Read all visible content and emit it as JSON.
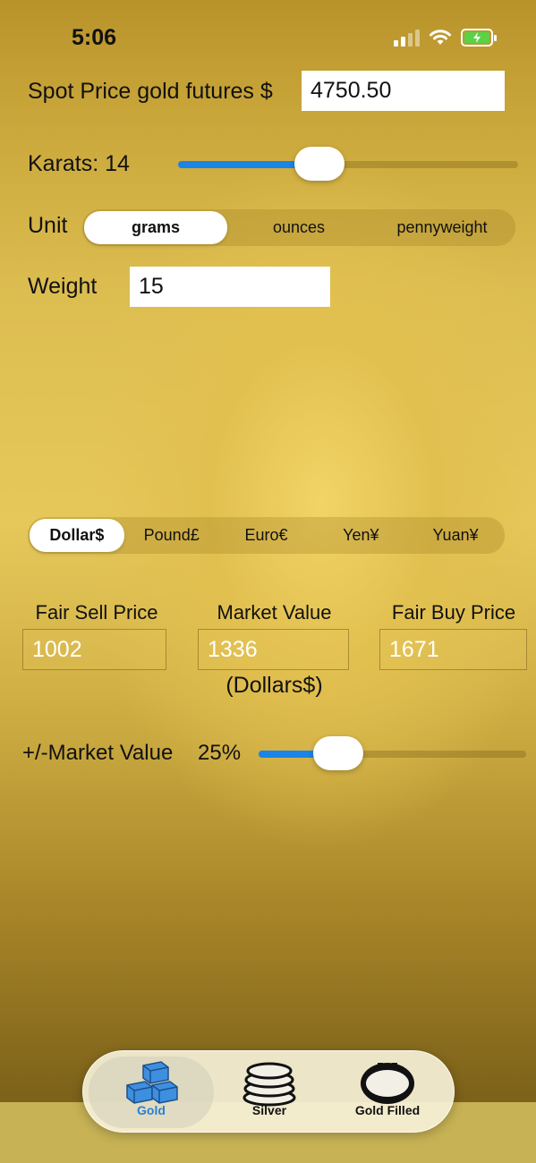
{
  "status_bar": {
    "time": "5:06"
  },
  "spot_price": {
    "label": "Spot Price gold futures $",
    "value": "4750.50"
  },
  "karats": {
    "label": "Karats: 14",
    "slider_fraction": 0.4
  },
  "unit": {
    "label": "Unit",
    "options": [
      "grams",
      "ounces",
      "pennyweight"
    ],
    "selected": "grams"
  },
  "weight": {
    "label": "Weight",
    "value": "15"
  },
  "currency": {
    "options": [
      "Dollar$",
      "Pound£",
      "Euro€",
      "Yen¥",
      "Yuan¥"
    ],
    "selected": "Dollar$"
  },
  "results": {
    "fair_sell": {
      "label": "Fair Sell Price",
      "value": "1002"
    },
    "market": {
      "label": "Market Value",
      "value": "1336",
      "currency_note": "(Dollars$)"
    },
    "fair_buy": {
      "label": "Fair Buy Price",
      "value": "1671"
    }
  },
  "market_adjust": {
    "label": "+/-Market Value",
    "percent_text": "25%",
    "slider_fraction": 0.25
  },
  "tabs": [
    {
      "label": "Gold",
      "icon": "gold-bars-icon",
      "active": true
    },
    {
      "label": "Silver",
      "icon": "silver-coins-icon",
      "active": false
    },
    {
      "label": "Gold Filled",
      "icon": "bracelet-icon",
      "active": false
    }
  ],
  "colors": {
    "accent": "#1a84e8",
    "tab_active": "#2a7fd6",
    "battery": "#5ad247"
  }
}
